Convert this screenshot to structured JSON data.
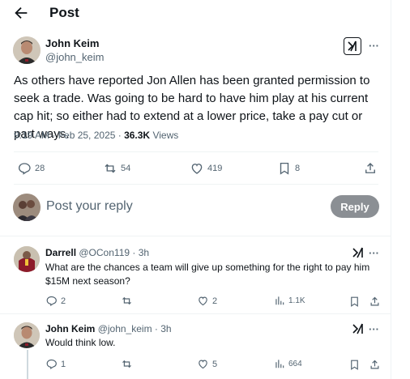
{
  "header": {
    "title": "Post"
  },
  "post": {
    "author_name": "John Keim",
    "author_handle": "@john_keim",
    "text": "As others have reported Jon Allen has been granted permission to seek a trade. Was going to be hard to have him play at his current cap hit; so either had to extend at a lower price, take a pay cut or part ways.",
    "timestamp": "9:19 AM · Feb 25, 2025 · ",
    "views_count": "36.3K",
    "views_label": " Views",
    "replies": "28",
    "reposts": "54",
    "likes": "419",
    "bookmarks": "8"
  },
  "compose": {
    "placeholder": "Post your reply",
    "button_label": "Reply"
  },
  "replies": [
    {
      "name": "Darrell",
      "handle_time": "@OCon119 · 3h",
      "text": "What are the chances a team will give up something for the right to pay him $15M next season?",
      "replies": "2",
      "reposts": "",
      "likes": "2",
      "views": "1.1K"
    },
    {
      "name": "John Keim",
      "handle_time": "@john_keim · 3h",
      "text": "Would think low.",
      "replies": "1",
      "reposts": "",
      "likes": "5",
      "views": "664"
    }
  ],
  "icons": {
    "back": "arrow-left-icon",
    "grok": "grok-icon",
    "more": "more-icon",
    "reply": "reply-icon",
    "repost": "repost-icon",
    "like": "heart-icon",
    "bookmark": "bookmark-icon",
    "share": "share-icon",
    "views": "views-icon"
  },
  "colors": {
    "text": "#0f1419",
    "muted": "#536471",
    "reply_button": "#8b8f94",
    "divider": "#eff3f4"
  },
  "more_glyph": "···"
}
